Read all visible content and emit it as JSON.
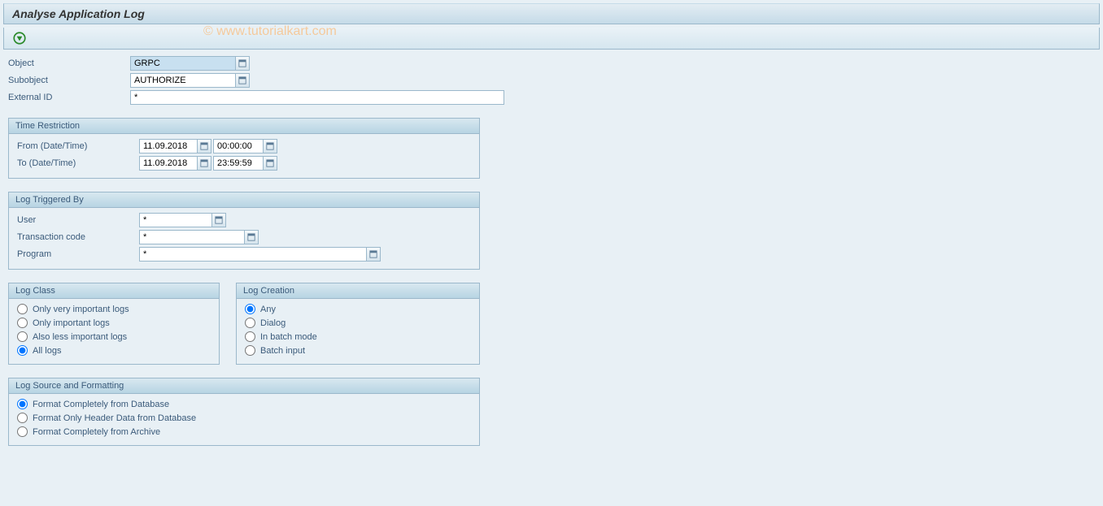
{
  "title": "Analyse Application Log",
  "watermark": "© www.tutorialkart.com",
  "fields": {
    "object_label": "Object",
    "object_value": "GRPC",
    "subobject_label": "Subobject",
    "subobject_value": "AUTHORIZE",
    "external_id_label": "External ID",
    "external_id_value": "*"
  },
  "time_restriction": {
    "header": "Time Restriction",
    "from_label": "From (Date/Time)",
    "from_date": "11.09.2018",
    "from_time": "00:00:00",
    "to_label": "To (Date/Time)",
    "to_date": "11.09.2018",
    "to_time": "23:59:59"
  },
  "log_triggered": {
    "header": "Log Triggered By",
    "user_label": "User",
    "user_value": "*",
    "tcode_label": "Transaction code",
    "tcode_value": "*",
    "program_label": "Program",
    "program_value": "*"
  },
  "log_class": {
    "header": "Log Class",
    "options": [
      "Only very important logs",
      "Only important logs",
      "Also less important logs",
      "All logs"
    ],
    "selected_index": 3
  },
  "log_creation": {
    "header": "Log Creation",
    "options": [
      "Any",
      "Dialog",
      "In batch mode",
      "Batch input"
    ],
    "selected_index": 0
  },
  "log_source": {
    "header": "Log Source and Formatting",
    "options": [
      "Format Completely from Database",
      "Format Only Header Data from Database",
      "Format Completely from Archive"
    ],
    "selected_index": 0
  }
}
